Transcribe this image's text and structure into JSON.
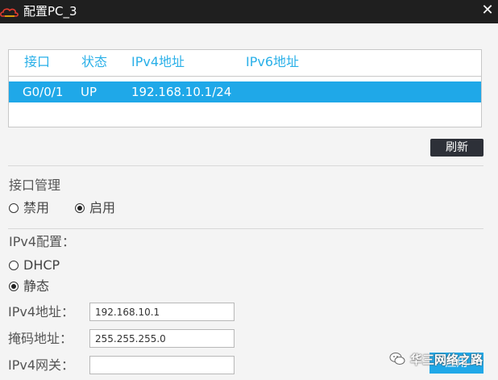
{
  "window": {
    "title": "配置PC_3",
    "close_glyph": "✕"
  },
  "interfaces": {
    "headers": [
      "接口",
      "状态",
      "IPv4地址",
      "IPv6地址"
    ],
    "rows": [
      {
        "port": "G0/0/1",
        "state": "UP",
        "ipv4": "192.168.10.1/24",
        "ipv6": ""
      }
    ]
  },
  "refresh_label": "刷新",
  "interface_mgmt": {
    "title": "接口管理",
    "options": [
      {
        "label": "禁用",
        "checked": false
      },
      {
        "label": "启用",
        "checked": true
      }
    ]
  },
  "ipv4_config": {
    "title": "IPv4配置：",
    "options": [
      {
        "label": "DHCP",
        "checked": false
      },
      {
        "label": "静态",
        "checked": true
      }
    ],
    "fields": [
      {
        "label": "IPv4地址：",
        "value": "192.168.10.1"
      },
      {
        "label": "掩码地址：",
        "value": "255.255.255.0"
      },
      {
        "label": "IPv4网关：",
        "value": ""
      }
    ]
  },
  "apply_label": "应用",
  "watermark": {
    "text": "华三网络之路",
    "icon": "wechat-icon"
  },
  "colors": {
    "accent": "#1fa8e8",
    "header_text": "#2ab0e8",
    "titlebar": "#1f1f1f",
    "refresh_bg": "#2d3038"
  }
}
